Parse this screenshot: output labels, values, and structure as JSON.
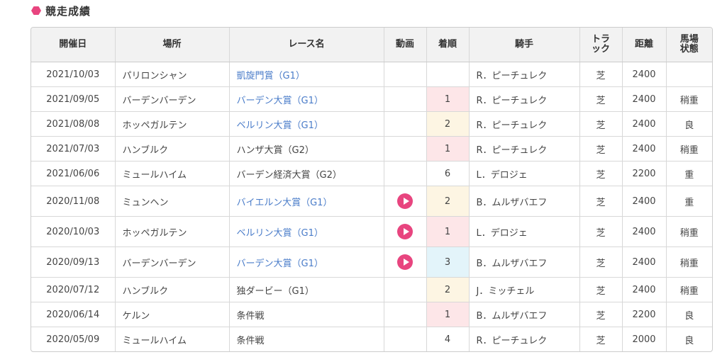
{
  "section": {
    "title": "競走成績"
  },
  "table": {
    "headers": {
      "date": "開催日",
      "venue": "場所",
      "race": "レース名",
      "video": "動画",
      "finish": "着順",
      "jockey": "騎手",
      "track": "トラック",
      "distance": "距離",
      "condition": "馬場状態"
    },
    "rows": [
      {
        "date": "2021/10/03",
        "venue": "パリロンシャン",
        "race": "凱旋門賞（G1）",
        "race_link": true,
        "video": false,
        "finish": "",
        "finish_rank": 0,
        "jockey": "R．ピーチュレク",
        "track": "芝",
        "distance": "2400",
        "condition": ""
      },
      {
        "date": "2021/09/05",
        "venue": "バーデンバーデン",
        "race": "バーデン大賞（G1）",
        "race_link": true,
        "video": false,
        "finish": "1",
        "finish_rank": 1,
        "jockey": "R．ピーチュレク",
        "track": "芝",
        "distance": "2400",
        "condition": "稍重"
      },
      {
        "date": "2021/08/08",
        "venue": "ホッペガルテン",
        "race": "ベルリン大賞（G1）",
        "race_link": true,
        "video": false,
        "finish": "2",
        "finish_rank": 2,
        "jockey": "R．ピーチュレク",
        "track": "芝",
        "distance": "2400",
        "condition": "良"
      },
      {
        "date": "2021/07/03",
        "venue": "ハンブルク",
        "race": "ハンザ大賞（G2）",
        "race_link": false,
        "video": false,
        "finish": "1",
        "finish_rank": 1,
        "jockey": "R．ピーチュレク",
        "track": "芝",
        "distance": "2400",
        "condition": "稍重"
      },
      {
        "date": "2021/06/06",
        "venue": "ミュールハイム",
        "race": "バーデン経済大賞（G2）",
        "race_link": false,
        "video": false,
        "finish": "6",
        "finish_rank": 0,
        "jockey": "L．デロジェ",
        "track": "芝",
        "distance": "2200",
        "condition": "重"
      },
      {
        "date": "2020/11/08",
        "venue": "ミュンヘン",
        "race": "バイエルン大賞（G1）",
        "race_link": true,
        "video": true,
        "finish": "2",
        "finish_rank": 2,
        "jockey": "B．ムルザバエフ",
        "track": "芝",
        "distance": "2400",
        "condition": "重"
      },
      {
        "date": "2020/10/03",
        "venue": "ホッペガルテン",
        "race": "ベルリン大賞（G1）",
        "race_link": true,
        "video": true,
        "finish": "1",
        "finish_rank": 1,
        "jockey": "L．デロジェ",
        "track": "芝",
        "distance": "2400",
        "condition": "稍重"
      },
      {
        "date": "2020/09/13",
        "venue": "バーデンバーデン",
        "race": "バーデン大賞（G1）",
        "race_link": true,
        "video": true,
        "finish": "3",
        "finish_rank": 3,
        "jockey": "B．ムルザバエフ",
        "track": "芝",
        "distance": "2400",
        "condition": "稍重"
      },
      {
        "date": "2020/07/12",
        "venue": "ハンブルク",
        "race": "独ダービー（G1）",
        "race_link": false,
        "video": false,
        "finish": "2",
        "finish_rank": 2,
        "jockey": "J．ミッチェル",
        "track": "芝",
        "distance": "2400",
        "condition": "稍重"
      },
      {
        "date": "2020/06/14",
        "venue": "ケルン",
        "race": "条件戦",
        "race_link": false,
        "video": false,
        "finish": "1",
        "finish_rank": 1,
        "jockey": "B．ムルザバエフ",
        "track": "芝",
        "distance": "2200",
        "condition": "良"
      },
      {
        "date": "2020/05/09",
        "venue": "ミュールハイム",
        "race": "条件戦",
        "race_link": false,
        "video": false,
        "finish": "4",
        "finish_rank": 0,
        "jockey": "R．ピーチュレク",
        "track": "芝",
        "distance": "2000",
        "condition": "良"
      }
    ]
  },
  "colors": {
    "accent": "#e8457f",
    "link": "#4a7cc9",
    "rank1_bg": "#fde6e8",
    "rank2_bg": "#fdf5e3",
    "rank3_bg": "#e3f4fa"
  },
  "icons": {
    "section_marker": "hexagon-icon",
    "video": "play-icon"
  }
}
